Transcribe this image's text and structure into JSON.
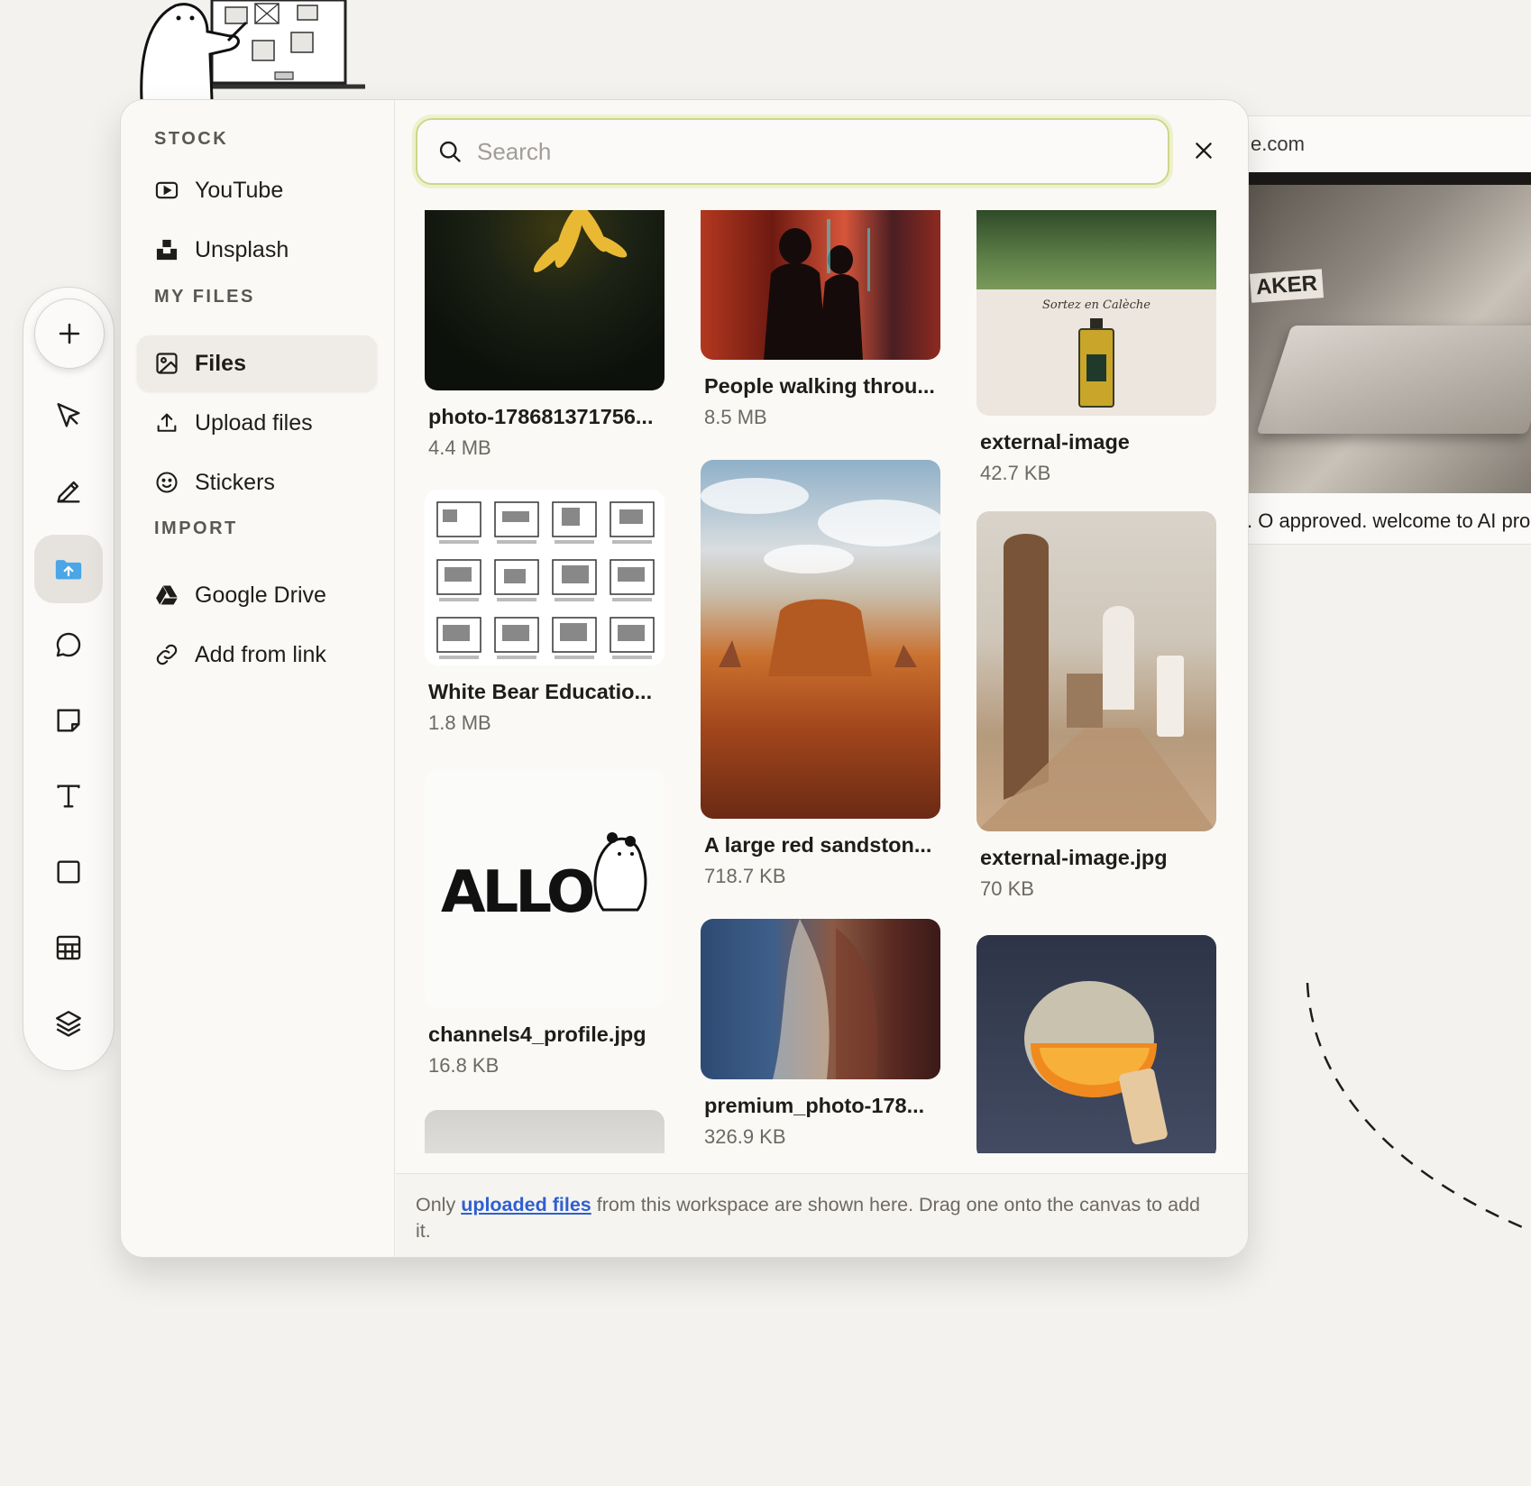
{
  "canvas": {
    "bg_card": {
      "url_text": "e.com",
      "thumb_text": "AKER",
      "caption": ". O approved. welcome to AI pro"
    }
  },
  "toolbar": {
    "tools": [
      {
        "icon": "plus-icon"
      },
      {
        "icon": "cursor-icon"
      },
      {
        "icon": "pen-icon"
      },
      {
        "icon": "folder-upload-icon",
        "active": true
      },
      {
        "icon": "comment-icon"
      },
      {
        "icon": "sticky-note-icon"
      },
      {
        "icon": "text-icon"
      },
      {
        "icon": "rectangle-icon"
      },
      {
        "icon": "table-icon"
      },
      {
        "icon": "layers-icon"
      }
    ]
  },
  "panel": {
    "sidebar": {
      "stock_title": "STOCK",
      "youtube": "YouTube",
      "unsplash": "Unsplash",
      "myfiles_title": "MY FILES",
      "files": "Files",
      "upload": "Upload files",
      "stickers": "Stickers",
      "import_title": "IMPORT",
      "gdrive": "Google Drive",
      "link": "Add from link"
    },
    "search": {
      "placeholder": "Search",
      "value": ""
    },
    "files": {
      "i1": {
        "name": "photo-178681371756...",
        "size": "4.4 MB"
      },
      "i2": {
        "name": "White Bear Educatio...",
        "size": "1.8 MB"
      },
      "i3": {
        "name": "channels4_profile.jpg",
        "size": "16.8 KB",
        "logo": "ALLO"
      },
      "i5": {
        "name": "People walking throu...",
        "size": "8.5 MB"
      },
      "i6": {
        "name": "A large red sandston...",
        "size": "718.7 KB"
      },
      "i7": {
        "name": "premium_photo-178...",
        "size": "326.9 KB"
      },
      "i8": {
        "name": "external-image",
        "size": "42.7 KB",
        "label": "Sortez en Calèche"
      },
      "i9": {
        "name": "external-image.jpg",
        "size": "70 KB"
      }
    },
    "footer": {
      "pre": "Only ",
      "link": "uploaded files",
      "post": " from this workspace are shown here. Drag one onto the canvas to add it."
    }
  },
  "colors": {
    "accent_link": "#2f5fd0",
    "search_focus": "#cfd68a",
    "active_folder": "#4aa6e6"
  }
}
